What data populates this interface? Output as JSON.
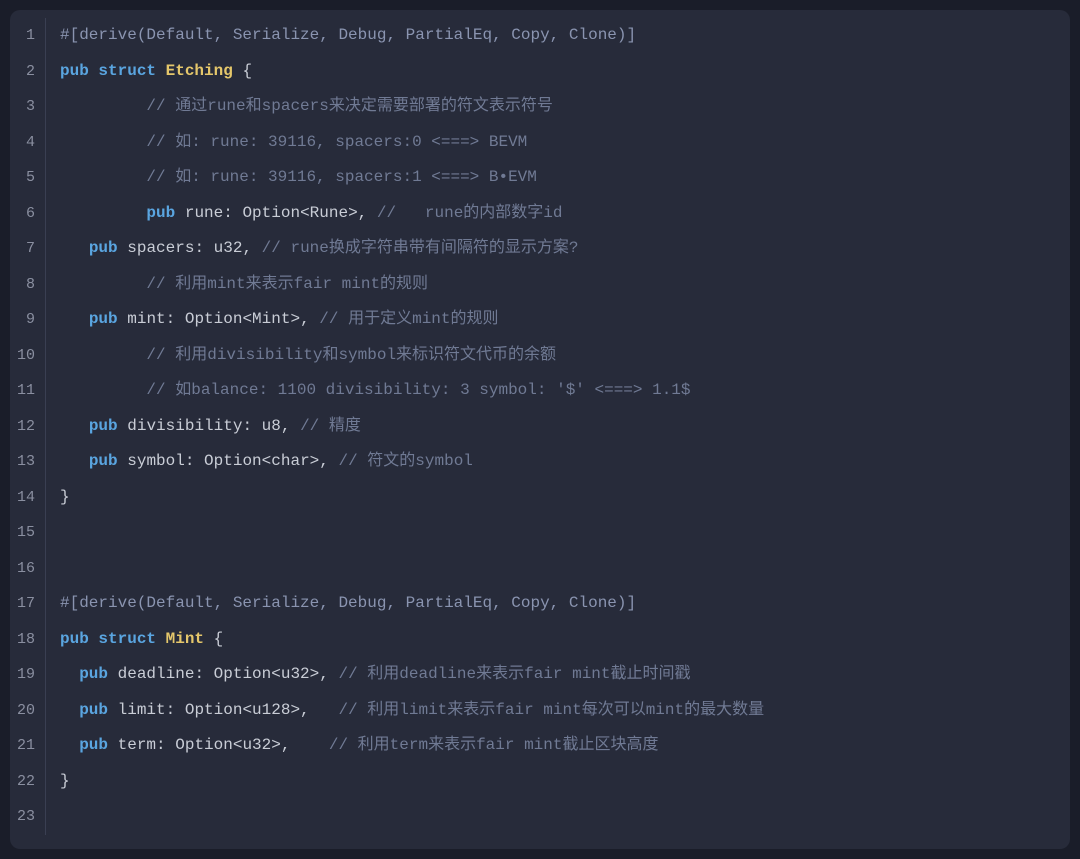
{
  "lines": [
    {
      "num": "1",
      "tokens": [
        {
          "cls": "tok-attr",
          "t": "#[derive(Default, Serialize, Debug, PartialEq, Copy, Clone)]"
        }
      ]
    },
    {
      "num": "2",
      "tokens": [
        {
          "cls": "tok-kw",
          "t": "pub struct"
        },
        {
          "cls": "",
          "t": " "
        },
        {
          "cls": "tok-struct",
          "t": "Etching"
        },
        {
          "cls": "",
          "t": " "
        },
        {
          "cls": "tok-punct",
          "t": "{"
        }
      ]
    },
    {
      "num": "3",
      "tokens": [
        {
          "cls": "",
          "t": "         "
        },
        {
          "cls": "tok-comment",
          "t": "// 通过rune和spacers来决定需要部署的符文表示符号"
        }
      ]
    },
    {
      "num": "4",
      "tokens": [
        {
          "cls": "",
          "t": "         "
        },
        {
          "cls": "tok-comment",
          "t": "// 如: rune: 39116, spacers:0 <===> BEVM"
        }
      ]
    },
    {
      "num": "5",
      "tokens": [
        {
          "cls": "",
          "t": "         "
        },
        {
          "cls": "tok-comment",
          "t": "// 如: rune: 39116, spacers:1 <===> B•EVM"
        }
      ]
    },
    {
      "num": "6",
      "tokens": [
        {
          "cls": "",
          "t": "         "
        },
        {
          "cls": "tok-kw",
          "t": "pub"
        },
        {
          "cls": "",
          "t": " "
        },
        {
          "cls": "tok-field",
          "t": "rune: Option<Rune>,"
        },
        {
          "cls": "",
          "t": " "
        },
        {
          "cls": "tok-comment",
          "t": "//   rune的内部数字id"
        }
      ]
    },
    {
      "num": "7",
      "tokens": [
        {
          "cls": "",
          "t": "   "
        },
        {
          "cls": "tok-kw",
          "t": "pub"
        },
        {
          "cls": "",
          "t": " "
        },
        {
          "cls": "tok-field",
          "t": "spacers: u32,"
        },
        {
          "cls": "",
          "t": " "
        },
        {
          "cls": "tok-comment",
          "t": "// rune换成字符串带有间隔符的显示方案?"
        }
      ]
    },
    {
      "num": "8",
      "tokens": [
        {
          "cls": "",
          "t": "         "
        },
        {
          "cls": "tok-comment",
          "t": "// 利用mint来表示fair mint的规则"
        }
      ]
    },
    {
      "num": "9",
      "tokens": [
        {
          "cls": "",
          "t": "   "
        },
        {
          "cls": "tok-kw",
          "t": "pub"
        },
        {
          "cls": "",
          "t": " "
        },
        {
          "cls": "tok-field",
          "t": "mint: Option<Mint>,"
        },
        {
          "cls": "",
          "t": " "
        },
        {
          "cls": "tok-comment",
          "t": "// 用于定义mint的规则"
        }
      ]
    },
    {
      "num": "10",
      "tokens": [
        {
          "cls": "",
          "t": "         "
        },
        {
          "cls": "tok-comment",
          "t": "// 利用divisibility和symbol来标识符文代币的余额"
        }
      ]
    },
    {
      "num": "11",
      "tokens": [
        {
          "cls": "",
          "t": "         "
        },
        {
          "cls": "tok-comment",
          "t": "// 如balance: 1100 divisibility: 3 symbol: '$' <===> 1.1$"
        }
      ]
    },
    {
      "num": "12",
      "tokens": [
        {
          "cls": "",
          "t": "   "
        },
        {
          "cls": "tok-kw",
          "t": "pub"
        },
        {
          "cls": "",
          "t": " "
        },
        {
          "cls": "tok-field",
          "t": "divisibility: u8,"
        },
        {
          "cls": "",
          "t": " "
        },
        {
          "cls": "tok-comment",
          "t": "// 精度"
        }
      ]
    },
    {
      "num": "13",
      "tokens": [
        {
          "cls": "",
          "t": "   "
        },
        {
          "cls": "tok-kw",
          "t": "pub"
        },
        {
          "cls": "",
          "t": " "
        },
        {
          "cls": "tok-field",
          "t": "symbol: Option<char>,"
        },
        {
          "cls": "",
          "t": " "
        },
        {
          "cls": "tok-comment",
          "t": "// 符文的symbol"
        }
      ]
    },
    {
      "num": "14",
      "tokens": [
        {
          "cls": "tok-punct",
          "t": "}"
        }
      ]
    },
    {
      "num": "15",
      "tokens": []
    },
    {
      "num": "16",
      "tokens": []
    },
    {
      "num": "17",
      "tokens": [
        {
          "cls": "tok-attr",
          "t": "#[derive(Default, Serialize, Debug, PartialEq, Copy, Clone)]"
        }
      ]
    },
    {
      "num": "18",
      "tokens": [
        {
          "cls": "tok-kw",
          "t": "pub struct"
        },
        {
          "cls": "",
          "t": " "
        },
        {
          "cls": "tok-struct",
          "t": "Mint"
        },
        {
          "cls": "",
          "t": " "
        },
        {
          "cls": "tok-punct",
          "t": "{"
        }
      ]
    },
    {
      "num": "19",
      "tokens": [
        {
          "cls": "",
          "t": "  "
        },
        {
          "cls": "tok-kw",
          "t": "pub"
        },
        {
          "cls": "",
          "t": " "
        },
        {
          "cls": "tok-field",
          "t": "deadline: Option<u32>,"
        },
        {
          "cls": "",
          "t": " "
        },
        {
          "cls": "tok-comment",
          "t": "// 利用deadline来表示fair mint截止时间戳"
        }
      ]
    },
    {
      "num": "20",
      "tokens": [
        {
          "cls": "",
          "t": "  "
        },
        {
          "cls": "tok-kw",
          "t": "pub"
        },
        {
          "cls": "",
          "t": " "
        },
        {
          "cls": "tok-field",
          "t": "limit: Option<u128>,"
        },
        {
          "cls": "",
          "t": "   "
        },
        {
          "cls": "tok-comment",
          "t": "// 利用limit来表示fair mint每次可以mint的最大数量"
        }
      ]
    },
    {
      "num": "21",
      "tokens": [
        {
          "cls": "",
          "t": "  "
        },
        {
          "cls": "tok-kw",
          "t": "pub"
        },
        {
          "cls": "",
          "t": " "
        },
        {
          "cls": "tok-field",
          "t": "term: Option<u32>,"
        },
        {
          "cls": "",
          "t": "    "
        },
        {
          "cls": "tok-comment",
          "t": "// 利用term来表示fair mint截止区块高度"
        }
      ]
    },
    {
      "num": "22",
      "tokens": [
        {
          "cls": "tok-punct",
          "t": "}"
        }
      ]
    },
    {
      "num": "23",
      "tokens": []
    }
  ]
}
